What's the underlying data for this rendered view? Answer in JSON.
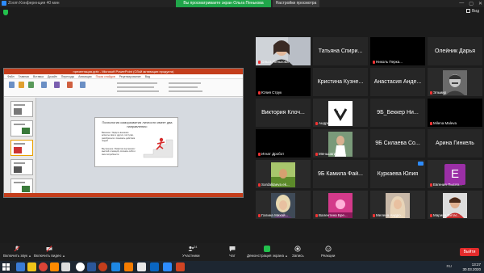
{
  "titlebar": {
    "app_title": "Zoom Конференция  40 мин",
    "viewing_banner": "Вы просматриваете экран Ольга Пенькова",
    "view_options": "Настройки просмотра",
    "controls": [
      "—",
      "▢",
      "✕"
    ]
  },
  "view_button": {
    "label": "Вид"
  },
  "share": {
    "ppt_title": "презентация.pptx - Microsoft PowerPoint (Сбой активации продукта)",
    "tabs": [
      "Файл",
      "Главная",
      "Вставка",
      "Дизайн",
      "Переходы",
      "Анимация",
      "Показ слайдов",
      "Рецензирование",
      "Вид"
    ],
    "active_tab": "Показ слайдов",
    "slide": {
      "title": "Психология саморазвития личности имеет два направления:",
      "bullet1": "Внешнее. Увидеть внешние аспекты свои и других, поступки, разобраться и понимать действия людей",
      "bullet2": "Внутреннее. Развитие внутренних мыслей и эмоций, осознать себя и свои потребности"
    }
  },
  "participants": [
    {
      "name": "Ольга Пенькова",
      "big": "",
      "type": "video-woman",
      "active": true
    },
    {
      "name": "",
      "big": "Татьяна Спири...",
      "type": "text"
    },
    {
      "name": "Николь Перка...",
      "big": "",
      "type": "black"
    },
    {
      "name": "",
      "big": "Олейник Дарья",
      "type": "text"
    },
    {
      "name": "Юлия Струк",
      "big": "",
      "type": "black"
    },
    {
      "name": "",
      "big": "Кристина Кузне...",
      "type": "text"
    },
    {
      "name": "",
      "big": "Анастасия Анде...",
      "type": "text"
    },
    {
      "name": "Эльмир",
      "big": "",
      "type": "portrait"
    },
    {
      "name": "",
      "big": "Виктория Клоч...",
      "type": "text"
    },
    {
      "name": "Андрей Попов",
      "big": "",
      "type": "vk"
    },
    {
      "name": "",
      "big": "9Б_Беккер Ни...",
      "type": "text"
    },
    {
      "name": "Milena Maleva",
      "big": "",
      "type": "black"
    },
    {
      "name": "Игнат Дробот",
      "big": "",
      "type": "black"
    },
    {
      "name": "Меньшагин Ал...",
      "big": "",
      "type": "man"
    },
    {
      "name": "",
      "big": "9Б Силаева Со...",
      "type": "text"
    },
    {
      "name": "",
      "big": "Арина Гинкель",
      "type": "text"
    },
    {
      "name": "Sordalitaeva ek...",
      "big": "",
      "type": "landscape"
    },
    {
      "name": "",
      "big": "9Б Камила Фай...",
      "type": "text"
    },
    {
      "name": "",
      "big": "Куркаева Юлия",
      "type": "text",
      "badge": true
    },
    {
      "name": "Евгения Пысло...",
      "big": "",
      "type": "avatar",
      "letter": "E"
    },
    {
      "name": "Галина Михай...",
      "big": "",
      "type": "blonde"
    },
    {
      "name": "Валентина Бре...",
      "big": "",
      "type": "pink"
    },
    {
      "name": "Мелена Андро...",
      "big": "",
      "type": "hair"
    },
    {
      "name": "Марина Витас...",
      "big": "",
      "type": "woman-red"
    }
  ],
  "toolbar": {
    "mute": "Включить звук",
    "video": "Включить видео",
    "participants": "Участники",
    "participants_count": "24",
    "chat": "Чат",
    "share": "Демонстрация экрана",
    "record": "Запись",
    "reactions": "Реакции",
    "end": "Выйти"
  },
  "taskbar": {
    "lang": "RU",
    "time": "13:27",
    "date": "30.03.2020"
  },
  "colors": {
    "zoom_blue": "#2d8cff",
    "share_green": "#23c14d",
    "ppt_red": "#c43e1c",
    "end_red": "#e32b2b"
  }
}
